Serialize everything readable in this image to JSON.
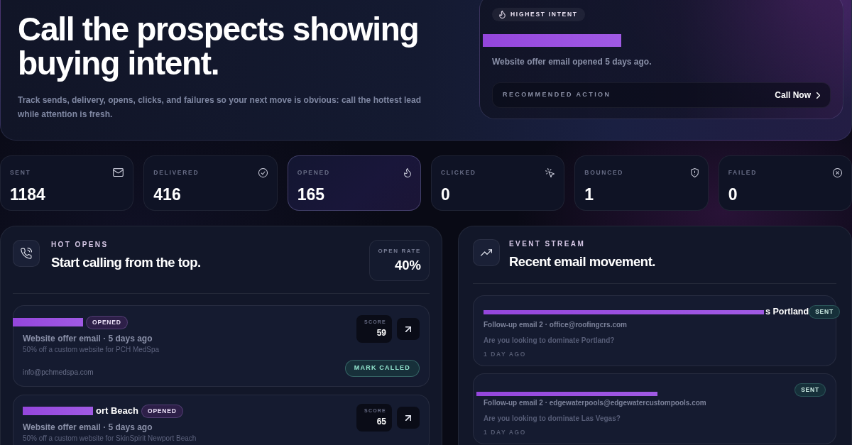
{
  "hero": {
    "title": "Call the prospects showing buying intent.",
    "subtitle": "Track sends, delivery, opens, clicks, and failures so your next move is obvious: call the hottest lead while attention is fresh."
  },
  "highest_intent": {
    "badge": "HIGHEST INTENT",
    "name_redacted": true,
    "detail": "Website offer email opened 5 days ago.",
    "action_label": "RECOMMENDED ACTION",
    "action_button": "Call Now"
  },
  "stats": [
    {
      "kind": "sent",
      "label": "SENT",
      "value": "1184",
      "highlighted": false
    },
    {
      "kind": "delivered",
      "label": "DELIVERED",
      "value": "416",
      "highlighted": false
    },
    {
      "kind": "opened",
      "label": "OPENED",
      "value": "165",
      "highlighted": true
    },
    {
      "kind": "clicked",
      "label": "CLICKED",
      "value": "0",
      "highlighted": false
    },
    {
      "kind": "bounced",
      "label": "BOUNCED",
      "value": "1",
      "highlighted": false
    },
    {
      "kind": "failed",
      "label": "FAILED",
      "value": "0",
      "highlighted": false
    }
  ],
  "hot_opens": {
    "eyebrow": "HOT OPENS",
    "title": "Start calling from the top.",
    "open_rate_label": "OPEN RATE",
    "open_rate": "40%",
    "items": [
      {
        "name_redacted": true,
        "status": "OPENED",
        "meta": "Website offer email · 5 days ago",
        "offer": "50% off a custom website for PCH MedSpa",
        "email": "info@pchmedspa.com",
        "score_label": "SCORE",
        "score": "59",
        "action": "MARK CALLED"
      },
      {
        "name_redacted": true,
        "name": "ort Beach",
        "status": "OPENED",
        "meta": "Website offer email · 5 days ago",
        "offer": "50% off a custom website for SkinSpirit Newport Beach",
        "score_label": "SCORE",
        "score": "65"
      }
    ]
  },
  "event_stream": {
    "eyebrow": "EVENT STREAM",
    "title": "Recent email movement.",
    "items": [
      {
        "title_redacted": true,
        "title": "s Portland",
        "status": "SENT",
        "meta": "Follow-up email 2 · office@roofingcrs.com",
        "preview": "Are you looking to dominate Portland?",
        "time": "1 DAY AGO"
      },
      {
        "title_redacted": true,
        "status": "SENT",
        "meta": "Follow-up email 2 · edgewaterpools@edgewatercustompools.com",
        "preview": "Are you looking to dominate Las Vegas?",
        "time": "1 DAY AGO"
      }
    ]
  }
}
